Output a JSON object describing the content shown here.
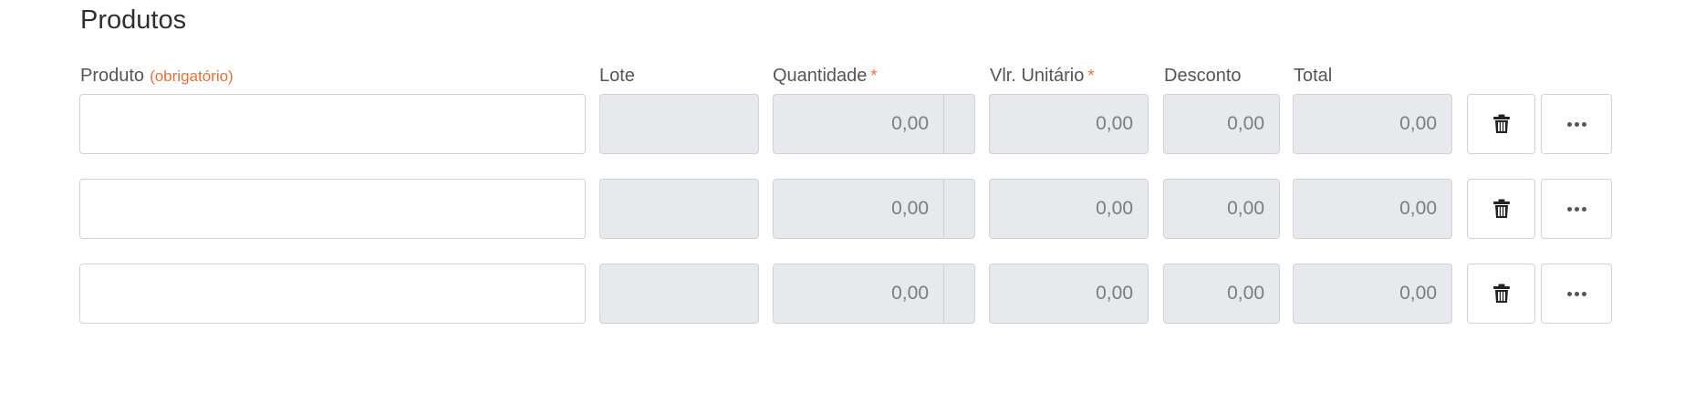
{
  "section": {
    "title": "Produtos"
  },
  "columns": {
    "produto": "Produto",
    "produto_note": "(obrigatório)",
    "lote": "Lote",
    "quantidade": "Quantidade",
    "quantidade_req": "*",
    "vlr_unitario": "Vlr. Unitário",
    "vlr_unitario_req": "*",
    "desconto": "Desconto",
    "total": "Total"
  },
  "rows": [
    {
      "produto": "",
      "lote": "",
      "quantidade": "0,00",
      "vlr_unitario": "0,00",
      "desconto": "0,00",
      "total": "0,00"
    },
    {
      "produto": "",
      "lote": "",
      "quantidade": "0,00",
      "vlr_unitario": "0,00",
      "desconto": "0,00",
      "total": "0,00"
    },
    {
      "produto": "",
      "lote": "",
      "quantidade": "0,00",
      "vlr_unitario": "0,00",
      "desconto": "0,00",
      "total": "0,00"
    }
  ],
  "icons": {
    "delete": "trash-icon",
    "more": "more-horizontal-icon"
  },
  "colors": {
    "accent": "#e8703a",
    "readonly_bg": "#e8e9ec",
    "border": "#cfd3d8"
  }
}
